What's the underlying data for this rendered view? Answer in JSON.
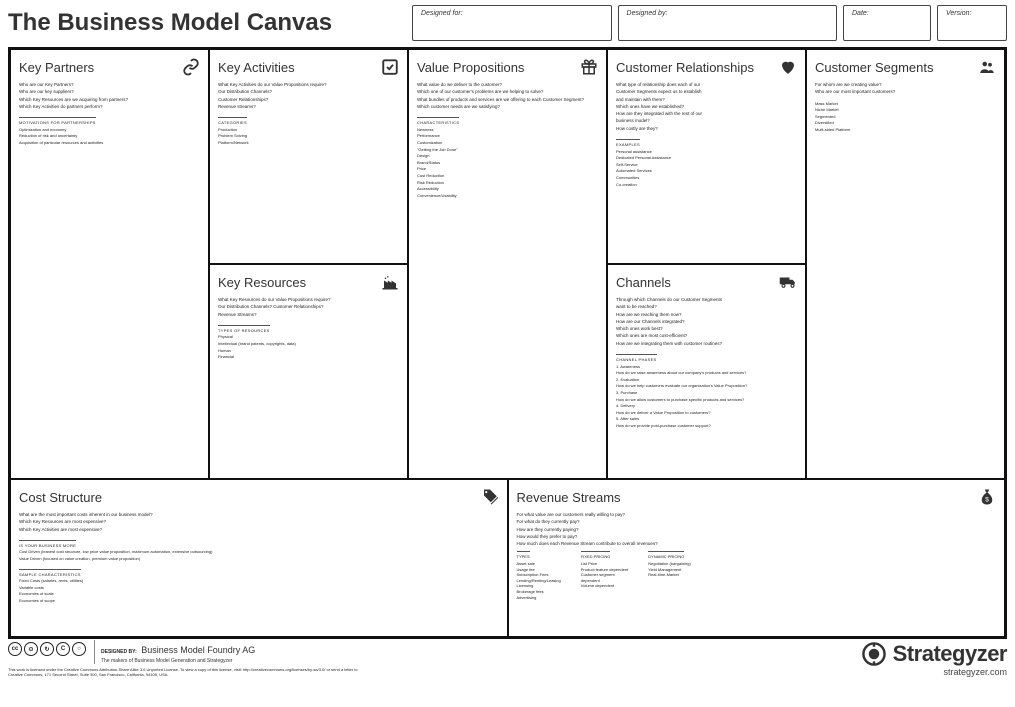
{
  "title": "The Business Model Canvas",
  "header": {
    "designed_for_label": "Designed for:",
    "designed_by_label": "Designed by:",
    "date_label": "Date:",
    "version_label": "Version:"
  },
  "blocks": {
    "kp": {
      "title": "Key Partners",
      "prompts": [
        "Who are our Key Partners?",
        "Who are our key suppliers?",
        "Which Key Resources are we acquiring from partners?",
        "Which Key Activities do partners perform?"
      ],
      "sub_head": "motivations for partnerships",
      "sub_items": [
        "Optimization and economy",
        "Reduction of risk and uncertainty",
        "Acquisition of particular resources and activities"
      ]
    },
    "ka": {
      "title": "Key Activities",
      "prompts": [
        "What Key Activities do our Value Propositions require?",
        "Our Distribution Channels?",
        "Customer Relationships?",
        "Revenue streams?"
      ],
      "sub_head": "categories",
      "sub_items": [
        "Production",
        "Problem Solving",
        "Platform/Network"
      ]
    },
    "kr": {
      "title": "Key Resources",
      "prompts": [
        "What Key Resources do our Value Propositions require?",
        "Our Distribution Channels? Customer Relationships?",
        "Revenue Streams?"
      ],
      "sub_head": "types of resources",
      "sub_items": [
        "Physical",
        "Intellectual (brand patents, copyrights, data)",
        "Human",
        "Financial"
      ]
    },
    "vp": {
      "title": "Value Propositions",
      "prompts": [
        "What value do we deliver to the customer?",
        "Which one of our customer's problems are we helping to solve?",
        "What bundles of products and services are we offering to each Customer Segment?",
        "Which customer needs are we satisfying?"
      ],
      "sub_head": "characteristics",
      "sub_items": [
        "Newness",
        "Performance",
        "Customization",
        "\"Getting the Job Done\"",
        "Design",
        "Brand/Status",
        "Price",
        "Cost Reduction",
        "Risk Reduction",
        "Accessibility",
        "Convenience/Usability"
      ]
    },
    "cr": {
      "title": "Customer Relationships",
      "prompts": [
        "What type of relationship does each of our",
        "Customer Segments expect us to establish",
        "and maintain with them?",
        "Which ones have we established?",
        "How are they integrated with the rest of our",
        "business model?",
        "How costly are they?"
      ],
      "sub_head": "examples",
      "sub_items": [
        "Personal assistance",
        "Dedicated Personal Assistance",
        "Self-Service",
        "Automated Services",
        "Communities",
        "Co-creation"
      ]
    },
    "ch": {
      "title": "Channels",
      "prompts": [
        "Through which Channels do our Customer Segments",
        "want to be reached?",
        "How are we reaching them now?",
        "How are our Channels integrated?",
        "Which ones work best?",
        "Which ones are most cost-efficient?",
        "How are we integrating them with customer routines?"
      ],
      "sub_head": "channel phases",
      "sub_items": [
        "1. Awareness",
        "   How do we raise awareness about our company's products and services?",
        "2. Evaluation",
        "   How do we help customers evaluate our organization's Value Proposition?",
        "3. Purchase",
        "   How do we allow customers to purchase specific products and services?",
        "4. Delivery",
        "   How do we deliver a Value Proposition to customers?",
        "5. After sales",
        "   How do we provide post-purchase customer support?"
      ]
    },
    "cs": {
      "title": "Customer Segments",
      "prompts": [
        "For whom are we creating value?",
        "Who are our most important customers?"
      ],
      "sub_items": [
        "Mass Market",
        "Niche Market",
        "Segmented",
        "Diversified",
        "Multi-sided Platform"
      ]
    },
    "cost": {
      "title": "Cost Structure",
      "prompts": [
        "What are the most important costs inherent in our business model?",
        "Which Key Resources are most expensive?",
        "Which Key Activities are most expensive?"
      ],
      "sub_head": "is your business more",
      "sub_items": [
        "Cost Driven (leanest cost structure, low price value proposition, maximum automation, extensive outsourcing)",
        "Value Driven (focused on value creation, premium value proposition)"
      ],
      "sub_head2": "sample characteristics",
      "sub_items2": [
        "Fixed Costs (salaries, rents, utilities)",
        "Variable costs",
        "Economies of scale",
        "Economies of scope"
      ]
    },
    "rev": {
      "title": "Revenue Streams",
      "prompts": [
        "For what value are our customers really willing to pay?",
        "For what do they currently pay?",
        "How are they currently paying?",
        "How would they prefer to pay?",
        "How much does each Revenue Stream contribute to overall revenues?"
      ],
      "cols": [
        {
          "head": "types",
          "items": [
            "Asset sale",
            "Usage fee",
            "Subscription Fees",
            "Lending/Renting/Leasing",
            "Licensing",
            "Brokerage fees",
            "Advertising"
          ]
        },
        {
          "head": "fixed pricing",
          "items": [
            "List Price",
            "Product feature dependent",
            "Customer segment",
            "dependent",
            "Volume dependent"
          ]
        },
        {
          "head": "dynamic pricing",
          "items": [
            "Negotiation (bargaining)",
            "Yield Management",
            "Real-time-Market"
          ]
        }
      ]
    }
  },
  "footer": {
    "designed_by_label": "DESIGNED BY:",
    "company": "Business Model Foundry AG",
    "tagline": "The makers of Business Model Generation and Strategyzer",
    "license": "This work is licensed under the Creative Commons Attribution-Share Alike 3.0 Unported License. To view a copy of this license, visit: http://creativecommons.org/licenses/by-sa/3.0/ or send a letter to Creative Commons, 171 Second Street, Suite 300, San Francisco, California, 94105, USA.",
    "brand_word": "Strategyzer",
    "brand_url": "strategyzer.com"
  }
}
